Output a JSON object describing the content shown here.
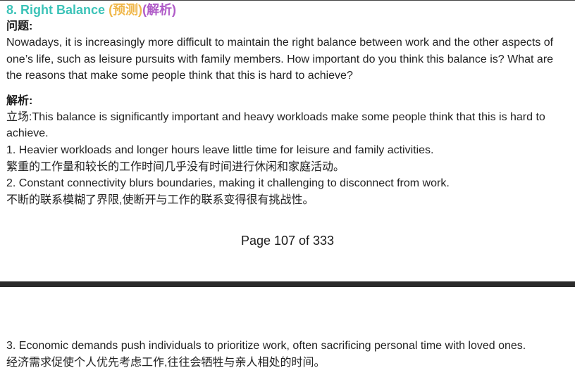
{
  "heading": {
    "number_title": "8. Right Balance",
    "predicted": "(预测)",
    "analysis": "(解析)"
  },
  "question": {
    "label": "问题:",
    "text": "Nowadays, it is increasingly more difficult to maintain the right balance between work and the other aspects of one’s life, such as leisure pursuits with family members. How important do you think this balance is? What are the reasons that make some people think that this is hard to achieve?"
  },
  "analysis": {
    "label": "解析:",
    "stance": "立场:This balance is significantly important and heavy workloads make some people think that this is hard to achieve.",
    "point1_en": "1. Heavier workloads and longer hours leave little time for leisure and family activities.",
    "point1_zh": "繁重的工作量和较长的工作时间几乎没有时间进行休闲和家庭活动。",
    "point2_en": "2. Constant connectivity blurs boundaries, making it challenging to disconnect from work.",
    "point2_zh": "不断的联系模糊了界限,使断开与工作的联系变得很有挑战性。",
    "point3_en": "3. Economic demands push individuals to prioritize work, often sacrificing personal time with loved ones.",
    "point3_zh": "经济需求促使个人优先考虑工作,往往会牺牲与亲人相处的时间。"
  },
  "footer": {
    "page_label": "Page 107 of 333"
  },
  "colors": {
    "title_teal": "#3cc3b8",
    "title_orange": "#f0b74a",
    "title_purple": "#b05cc8",
    "divider": "#2b2b2b"
  }
}
